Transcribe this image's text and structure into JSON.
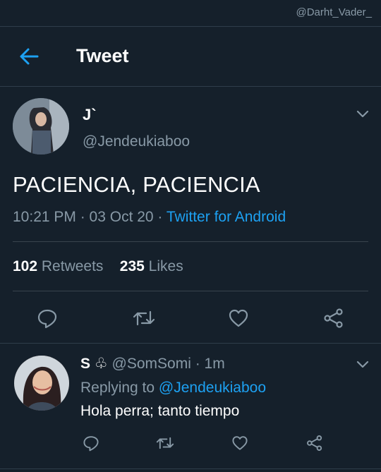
{
  "watermark": "@Darht_Vader_",
  "header": {
    "title": "Tweet",
    "back_icon": "back-arrow-icon"
  },
  "tweet": {
    "author_name": "J`",
    "author_handle": "@Jendeukiaboo",
    "text": "PACIENCIA, PACIENCIA",
    "time": "10:21 PM · 03 Oct 20 · ",
    "source": "Twitter for Android",
    "retweets_count": "102",
    "retweets_label": "Retweets",
    "likes_count": "235",
    "likes_label": "Likes"
  },
  "reply": {
    "name": "S",
    "handle": "@SomSomi",
    "time": "· 1m",
    "replying_label": "Replying to",
    "replying_to": "@Jendeukiaboo",
    "text": "Hola perra; tanto tiempo"
  },
  "colors": {
    "background": "#15202b",
    "accent": "#1da1f2",
    "muted": "#8899a6",
    "divider": "#38444d"
  },
  "icons": [
    "back-arrow-icon",
    "chevron-down-icon",
    "reply-icon",
    "retweet-icon",
    "like-icon",
    "share-icon",
    "club-suit-icon"
  ]
}
